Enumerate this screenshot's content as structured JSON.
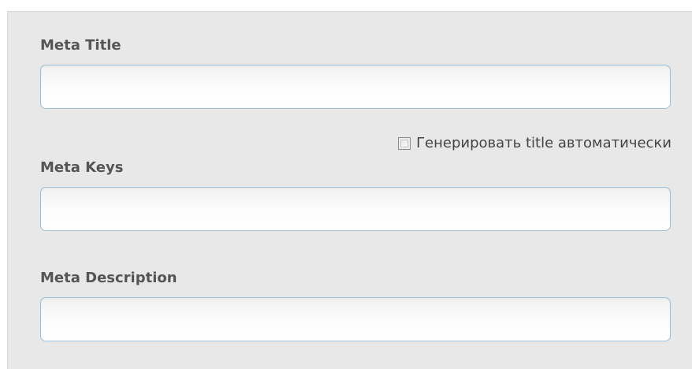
{
  "form": {
    "meta_title": {
      "label": "Meta Title",
      "value": "",
      "placeholder": ""
    },
    "auto_title_checkbox": {
      "label": "Генерировать title автоматически",
      "checked": false
    },
    "meta_keys": {
      "label": "Meta Keys",
      "value": "",
      "placeholder": ""
    },
    "meta_description": {
      "label": "Meta Description",
      "value": "",
      "placeholder": ""
    }
  },
  "colors": {
    "panel_background": "#e8e8e8",
    "input_border": "#9fc1d9",
    "label_text": "#555555"
  }
}
